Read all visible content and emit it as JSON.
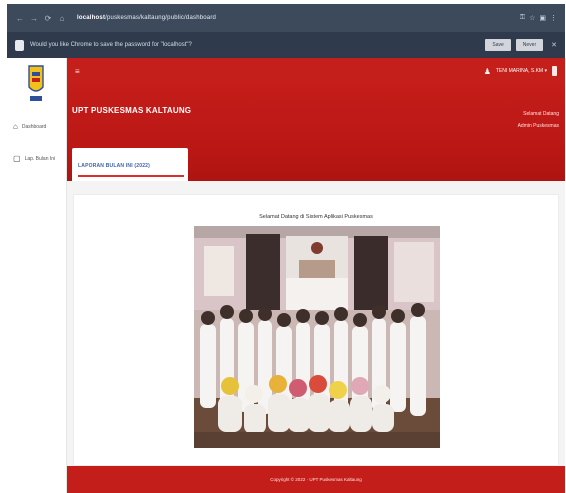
{
  "browser": {
    "url_host": "localhost",
    "url_path": "/puskesmas/kaltaung/public/dashboard",
    "nav_back": "←",
    "nav_forward": "→",
    "nav_reload": "⟳",
    "nav_home": "⌂"
  },
  "infobar": {
    "message": "Would you like Chrome to save the password for \"localhost\"?",
    "save_label": "Save",
    "never_label": "Never",
    "close_glyph": "✕"
  },
  "sidebar": {
    "items": [
      {
        "label": "Dashboard",
        "icon": "home-icon"
      },
      {
        "label": "Lap. Bulan Ini",
        "icon": "document-icon"
      }
    ]
  },
  "topbar": {
    "menu_glyph": "≡",
    "user_label": "TENI MARINA, S.KM ▾"
  },
  "hero": {
    "title": "UPT PUSKESMAS KALTAUNG",
    "right_line1": "Selamat Datang",
    "right_line2": "Admin Puskesmas"
  },
  "tab": {
    "label": "LAPORAN BULAN INI (2022)"
  },
  "content": {
    "caption": "Selamat Datang di Sistem Aplikasi Puskesmas"
  },
  "footer": {
    "text": "Copyright © 2022 · UPT Puskesmas Kaltaung"
  },
  "colors": {
    "brand_red": "#c51f1b",
    "chrome_dark": "#3d4a5c",
    "tab_blue": "#3a5fb0"
  }
}
